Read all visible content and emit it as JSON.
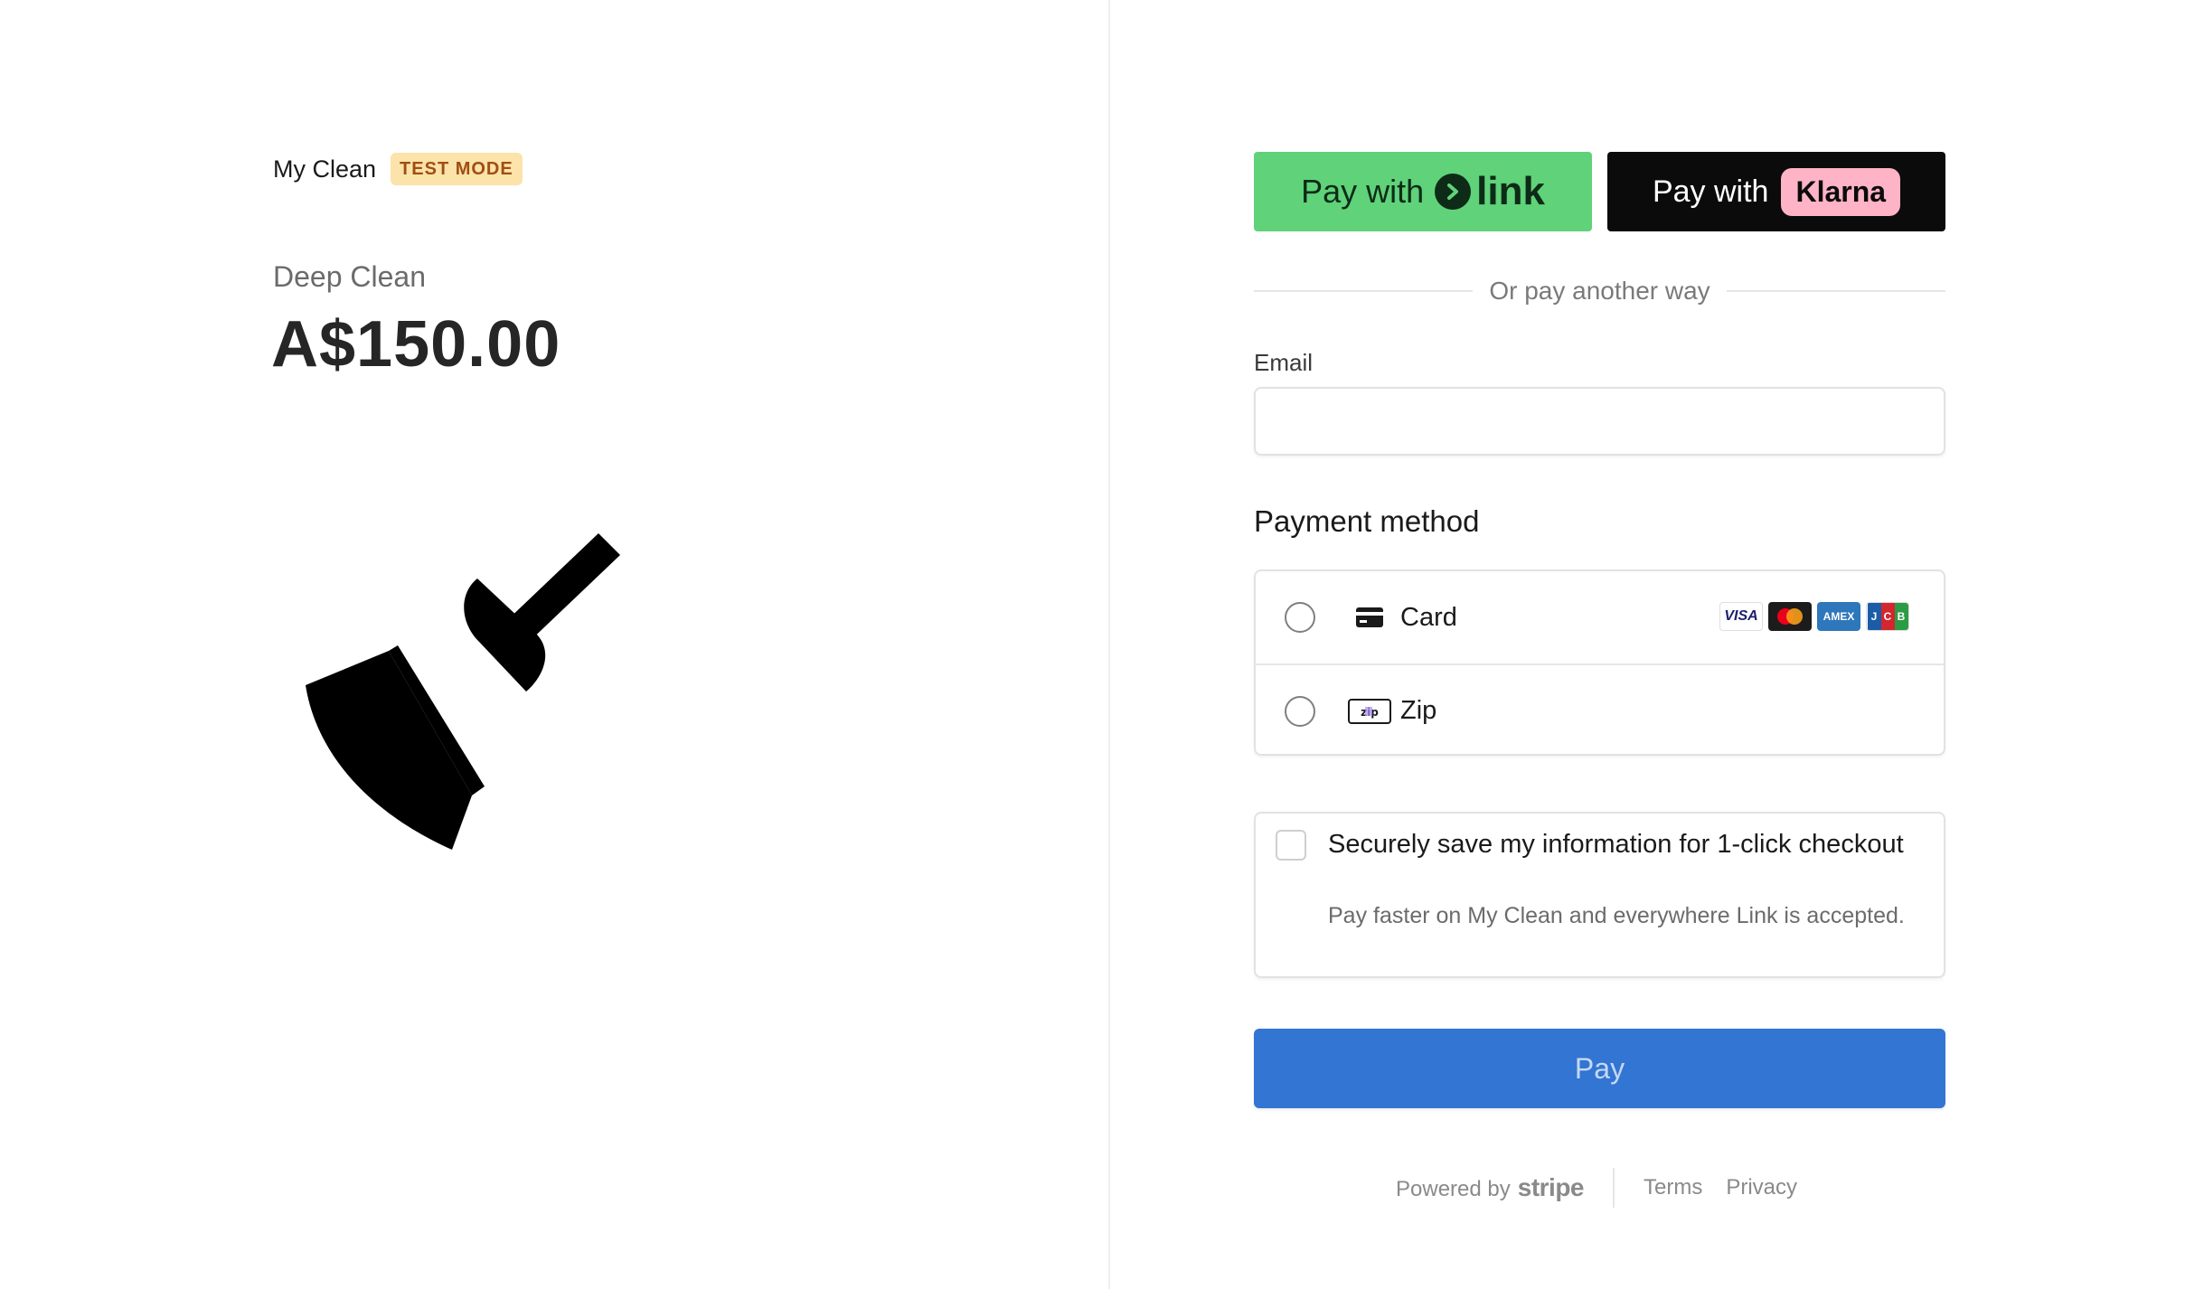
{
  "merchant": {
    "name": "My Clean",
    "badge": "TEST MODE"
  },
  "product": {
    "name": "Deep Clean",
    "price": "A$150.00",
    "image_icon": "broom-icon"
  },
  "wallets": {
    "link": {
      "prefix": "Pay with",
      "brand": "link",
      "color": "#5fd27a"
    },
    "klarna": {
      "prefix": "Pay with",
      "brand": "Klarna",
      "color": "#0b0b0b",
      "pill_color": "#ffb3c7"
    }
  },
  "divider_text": "Or pay another way",
  "email": {
    "label": "Email",
    "value": "",
    "placeholder": ""
  },
  "payment_method": {
    "heading": "Payment method",
    "options": [
      {
        "label": "Card",
        "icon": "credit-card-icon",
        "brands": [
          "VISA",
          "mastercard",
          "AMEX",
          "JCB"
        ]
      },
      {
        "label": "Zip",
        "icon": "zip-logo-icon"
      }
    ]
  },
  "save_info": {
    "title": "Securely save my information for 1-click checkout",
    "description": "Pay faster on My Clean and everywhere Link is accepted."
  },
  "pay_button": {
    "label": "Pay",
    "color": "#3275d3"
  },
  "footer": {
    "powered_by": "Powered by",
    "brand": "stripe",
    "links": [
      "Terms",
      "Privacy"
    ]
  }
}
